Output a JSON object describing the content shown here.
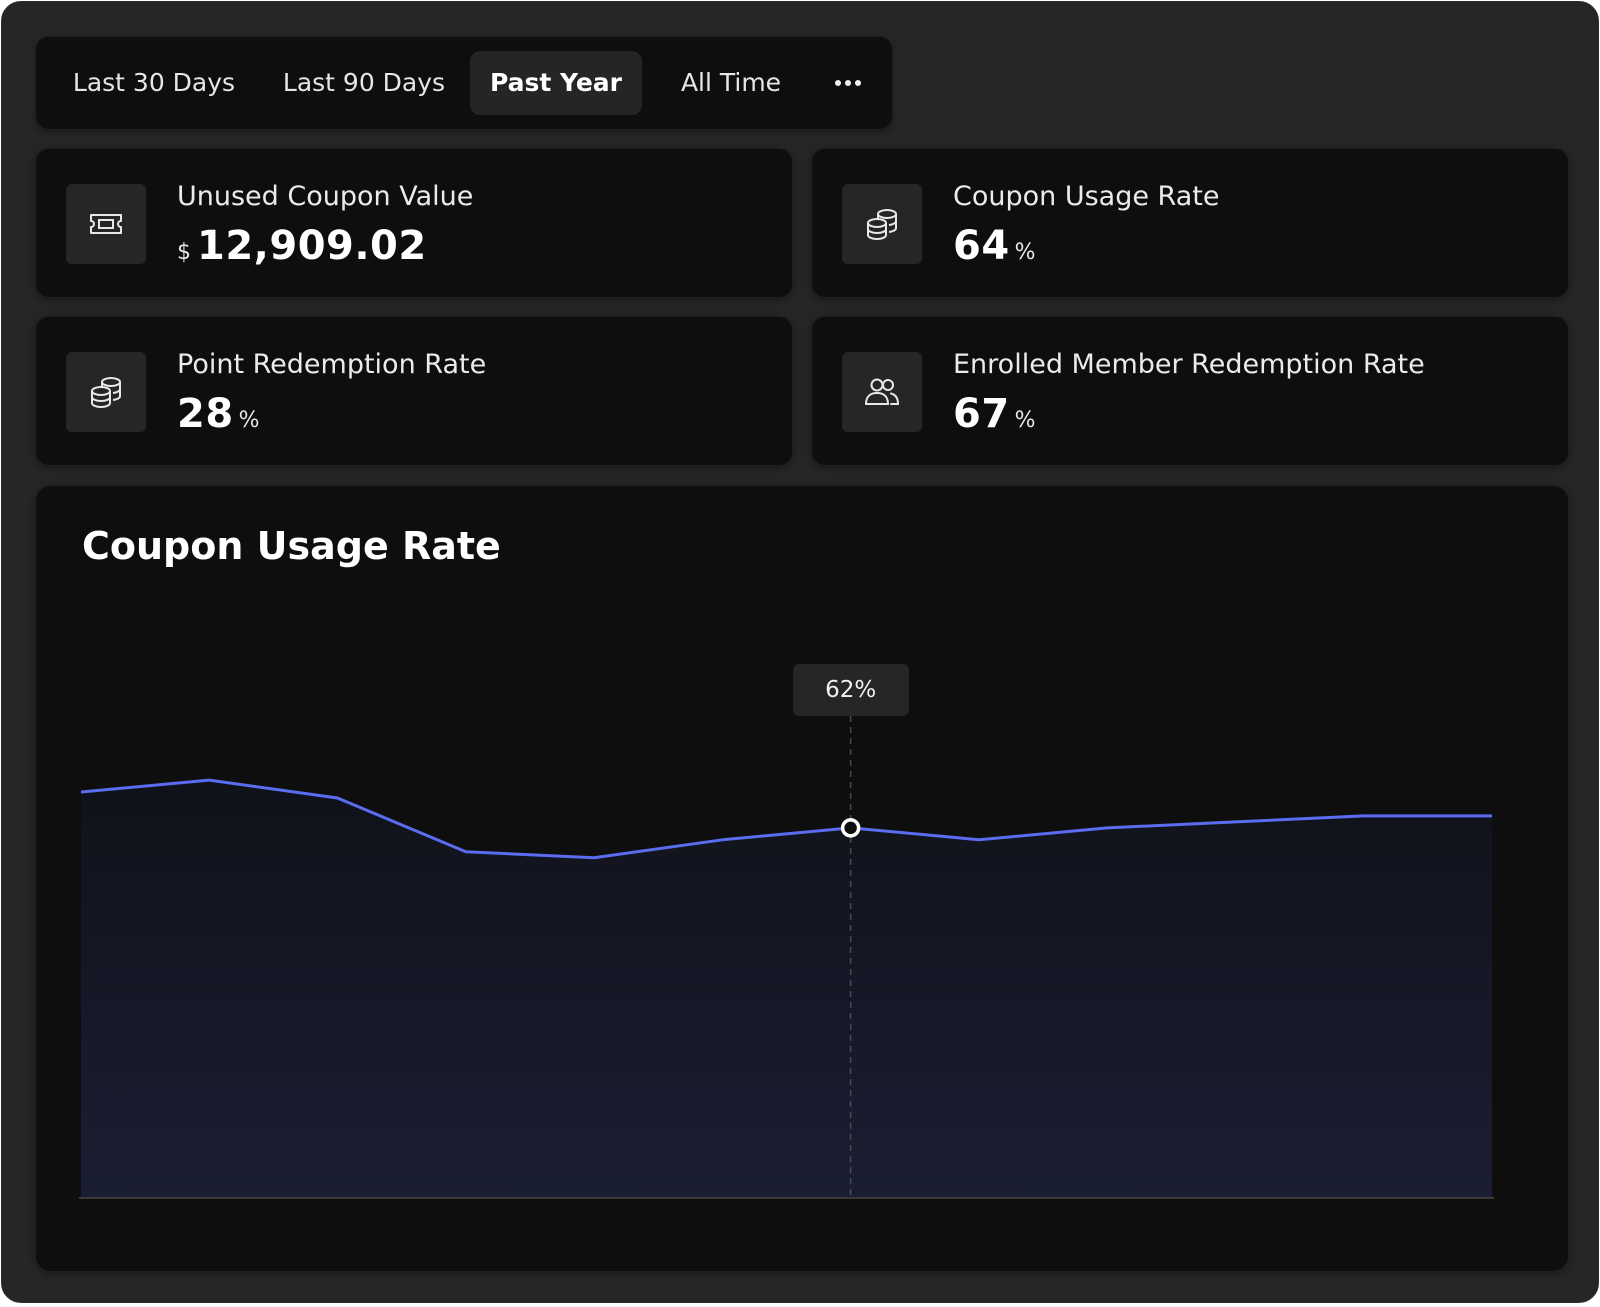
{
  "tabs": {
    "items": [
      {
        "label": "Last 30 Days",
        "active": false
      },
      {
        "label": "Last 90 Days",
        "active": false
      },
      {
        "label": "Past Year",
        "active": true
      },
      {
        "label": "All Time",
        "active": false
      }
    ],
    "more_icon": "more-horizontal-icon"
  },
  "cards": {
    "unused_coupon_value": {
      "label": "Unused Coupon Value",
      "prefix": "$",
      "value": "12,909.02",
      "icon": "ticket-icon"
    },
    "coupon_usage_rate": {
      "label": "Coupon Usage Rate",
      "value": "64",
      "unit": "%",
      "icon": "coins-icon"
    },
    "point_redemption_rate": {
      "label": "Point Redemption Rate",
      "value": "28",
      "unit": "%",
      "icon": "coins-icon"
    },
    "enrolled_member_redemption_rate": {
      "label": "Enrolled Member Redemption Rate",
      "value": "67",
      "unit": "%",
      "icon": "users-icon"
    }
  },
  "chart": {
    "title": "Coupon Usage Rate",
    "tooltip": "62%",
    "line_color": "#5a6cf0"
  },
  "chart_data": {
    "type": "area",
    "title": "Coupon Usage Rate",
    "xlabel": "",
    "ylabel": "",
    "ylim": [
      0,
      100
    ],
    "grid": false,
    "series": [
      {
        "values": [
          68,
          70,
          67,
          58,
          57,
          60,
          62,
          60,
          62,
          63,
          64,
          64
        ]
      }
    ],
    "highlight_index": 6,
    "highlight_label": "62%"
  }
}
